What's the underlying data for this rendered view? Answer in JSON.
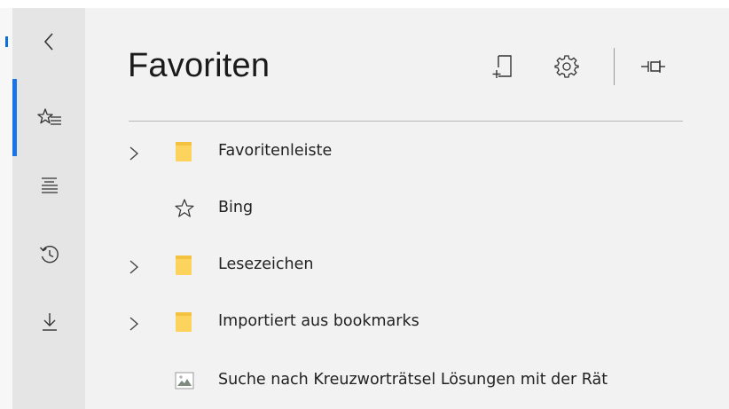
{
  "rail": {
    "items": [
      {
        "name": "back",
        "icon": "chevron-left-icon"
      },
      {
        "name": "favorites",
        "icon": "favorites-star-list-icon",
        "active": true
      },
      {
        "name": "reading-list",
        "icon": "reading-list-icon"
      },
      {
        "name": "history",
        "icon": "history-icon"
      },
      {
        "name": "downloads",
        "icon": "download-arrow-icon"
      }
    ],
    "accent_color": "#1a73e8"
  },
  "panel": {
    "title": "Favoriten",
    "actions": [
      {
        "name": "add-favorite",
        "icon": "add-favorite-icon"
      },
      {
        "name": "settings",
        "icon": "gear-icon"
      },
      {
        "name": "pin",
        "icon": "pin-icon"
      }
    ]
  },
  "favorites": [
    {
      "type": "folder",
      "label": "Favoritenleiste",
      "expandable": true,
      "icon": "folder-icon"
    },
    {
      "type": "link",
      "label": "Bing",
      "expandable": false,
      "icon": "star-outline-icon"
    },
    {
      "type": "folder",
      "label": "Lesezeichen",
      "expandable": true,
      "icon": "folder-icon"
    },
    {
      "type": "folder",
      "label": "Importiert aus bookmarks",
      "expandable": true,
      "icon": "folder-icon"
    },
    {
      "type": "link",
      "label": "Suche nach Kreuzworträtsel Lösungen mit der Rät",
      "expandable": false,
      "icon": "site-thumbnail-icon"
    }
  ],
  "colors": {
    "folder": "#fcd35c",
    "panel_bg": "#f2f2f2",
    "rail_bg": "#e5e5e5"
  }
}
